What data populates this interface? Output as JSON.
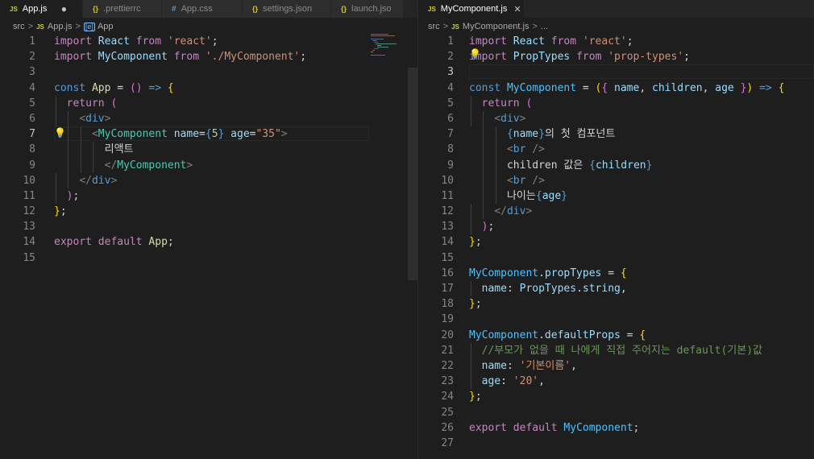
{
  "left": {
    "tabs": [
      {
        "icon": "JS",
        "name": "App.js",
        "active": true,
        "dirty": "●"
      },
      {
        "icon": "{}",
        "name": ".prettierrc"
      },
      {
        "icon": "#",
        "name": "App.css"
      },
      {
        "icon": "{}",
        "name": "settings.json"
      },
      {
        "icon": "{}",
        "name": "launch.jso"
      }
    ],
    "breadcrumb": {
      "folder": "src",
      "sep": ">",
      "file_icon": "JS",
      "file": "App.js",
      "symbol_icon": "[e]",
      "symbol": "App"
    },
    "line_numbers": [
      "1",
      "2",
      "3",
      "4",
      "5",
      "6",
      "7",
      "8",
      "9",
      "10",
      "11",
      "12",
      "13",
      "14",
      "15"
    ],
    "current_line": "7",
    "code": {
      "l1": [
        "import",
        "React",
        "from",
        "'react'",
        ";"
      ],
      "l2": [
        "import",
        "MyComponent",
        "from",
        "'./MyComponent'",
        ";"
      ],
      "l4": [
        "const",
        "App",
        "=",
        "()",
        "=>",
        "{"
      ],
      "l5": [
        "return",
        "("
      ],
      "l6": [
        "<",
        "div",
        ">"
      ],
      "l7": [
        "<",
        "MyComponent",
        "name",
        "=",
        "{",
        "5",
        "}",
        "age",
        "=",
        "\"35\"",
        ">"
      ],
      "l8": [
        "리액트"
      ],
      "l9": [
        "</",
        "MyComponent",
        ">"
      ],
      "l10": [
        "</",
        "div",
        ">"
      ],
      "l11": [
        ")",
        ";"
      ],
      "l12": [
        "}",
        ";"
      ],
      "l14": [
        "export",
        "default",
        "App",
        ";"
      ]
    }
  },
  "right": {
    "tabs": [
      {
        "icon": "JS",
        "name": "MyComponent.js",
        "active": true,
        "close": "✕"
      }
    ],
    "breadcrumb": {
      "folder": "src",
      "sep": ">",
      "file_icon": "JS",
      "file": "MyComponent.js",
      "trail": "..."
    },
    "line_numbers": [
      "1",
      "2",
      "3",
      "4",
      "5",
      "6",
      "7",
      "8",
      "9",
      "10",
      "11",
      "12",
      "13",
      "14",
      "15",
      "16",
      "17",
      "18",
      "19",
      "20",
      "21",
      "22",
      "23",
      "24",
      "25",
      "26",
      "27"
    ],
    "current_line": "3",
    "code": {
      "l1": [
        "import",
        "React",
        "from",
        "'react'",
        ";"
      ],
      "l2": [
        "import",
        "PropTypes",
        "from",
        "'prop-types'",
        ";"
      ],
      "l4": [
        "const",
        "MyComponent",
        "=",
        "(",
        "{",
        "name",
        ",",
        "children",
        ",",
        "age",
        "}",
        ")",
        "=>",
        "{"
      ],
      "l5": [
        "return",
        "("
      ],
      "l6": [
        "<",
        "div",
        ">"
      ],
      "l7": [
        "{",
        "name",
        "}",
        "의 첫 컴포넌트"
      ],
      "l8": [
        "<",
        "br",
        "/>"
      ],
      "l9": [
        "children 값은 ",
        "{",
        "children",
        "}"
      ],
      "l10": [
        "<",
        "br",
        "/>"
      ],
      "l11": [
        "나이는",
        "{",
        "age",
        "}"
      ],
      "l12": [
        "</",
        "div",
        ">"
      ],
      "l13": [
        ")",
        ";"
      ],
      "l14": [
        "}",
        ";"
      ],
      "l16": [
        "MyComponent",
        ".",
        "propTypes",
        "=",
        "{"
      ],
      "l17": [
        "name",
        ":",
        "PropTypes",
        ".",
        "string",
        ","
      ],
      "l18": [
        "}",
        ";"
      ],
      "l20": [
        "MyComponent",
        ".",
        "defaultProps",
        "=",
        "{"
      ],
      "l21": [
        "//부모가 없을 때 나에게 직접 주어지는 default(기본)값"
      ],
      "l22": [
        "name",
        ":",
        "'기본이름'",
        ","
      ],
      "l23": [
        "age",
        ":",
        "'20'",
        ","
      ],
      "l24": [
        "}",
        ";"
      ],
      "l26": [
        "export",
        "default",
        "MyComponent",
        ";"
      ]
    }
  }
}
